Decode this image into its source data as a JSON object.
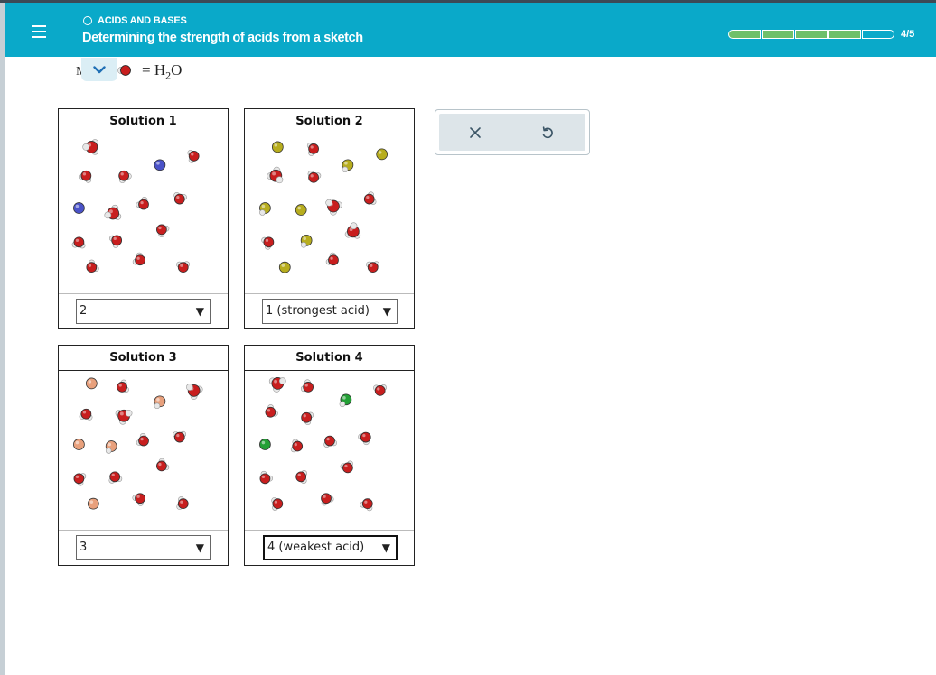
{
  "header": {
    "topic": "ACIDS AND BASES",
    "title": "Determining the strength of acids from a sketch",
    "progress_text": "4/5",
    "progress": {
      "completed": 4,
      "total": 5
    }
  },
  "legend": {
    "partial_text": "M",
    "equation_prefix": "= H",
    "equation_sub": "2",
    "equation_suffix": "O"
  },
  "solutions": [
    {
      "title": "Solution 1",
      "selected": "2",
      "icon": "molecule-sketch"
    },
    {
      "title": "Solution 2",
      "selected": "1 (strongest acid)",
      "icon": "molecule-sketch"
    },
    {
      "title": "Solution 3",
      "selected": "3",
      "icon": "molecule-sketch"
    },
    {
      "title": "Solution 4",
      "selected": "4 (weakest acid)",
      "icon": "molecule-sketch"
    }
  ],
  "tools": {
    "clear_icon": "close-icon",
    "undo_icon": "undo-icon"
  },
  "colors": {
    "header": "#0aa9c9",
    "progress_fill": "#6ec06a",
    "oxygen": "#c81e1e",
    "hydrogen": "#e8e8e8",
    "anion_solution1": "#4a52c8",
    "anion_solution2": "#b7ad1e",
    "anion_solution3": "#e8a07c",
    "anion_solution4": "#23a035"
  }
}
